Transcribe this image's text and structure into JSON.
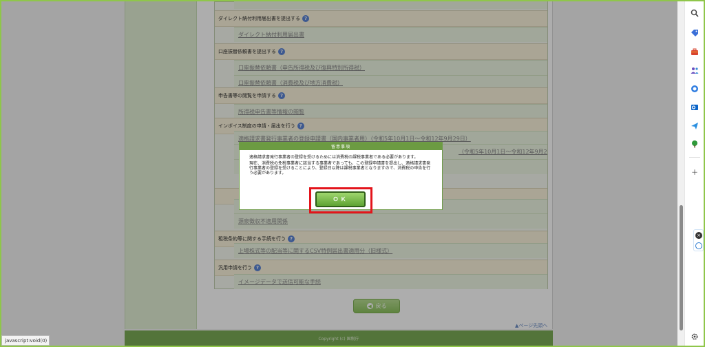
{
  "sections": [
    {
      "title": "ダイレクト納付利用届出書を提出する",
      "links": [
        "ダイレクト納付利用届出書"
      ]
    },
    {
      "title": "口座振替依頼書を提出する",
      "links": [
        "口座振替依頼書（申告所得税及び復興特別所得税）",
        "口座振替依頼書（消費税及び地方消費税）"
      ]
    },
    {
      "title": "申告書等の閲覧を申請する",
      "links": [
        "所得税申告書等情報の閲覧"
      ]
    },
    {
      "title": "インボイス制度の申請・届出を行う",
      "links": [
        "適格請求書発行事業者の登録申請書（国内事業者用）（令和5年10月1日～令和12年9月29日）",
        "（令和5年10月1日～令和12年9月29日）"
      ]
    },
    {
      "title": "",
      "links": [
        "源泉徴収不適用関係"
      ]
    },
    {
      "title": "租税条約等に関する手続を行う",
      "links": [
        "上場株式等の配当等に関するCSV特例届出書適用分（旧様式）"
      ]
    },
    {
      "title": "汎用申請を行う",
      "links": [
        "イメージデータで送信可能な手続"
      ]
    }
  ],
  "back_button": "戻る",
  "to_top": "ページ先頭へ",
  "footer": "Copyright (c) 国税庁",
  "modal": {
    "title": "留意事項",
    "paragraph1": "適格請求書発行事業者の登録を受けるためには消費税の課税事業者である必要があります。",
    "paragraph2": "現在、消費税の免税事業者に該当する事業者であっても、この登録申請書を提出し、適格請求書発行事業者の登録を受けることにより、登録日以降は課税事業者となりますので、消費税の申告を行う必要があります。",
    "ok_label": "ＯＫ"
  },
  "status_bar": "javascript:void(0)",
  "right_bar_icons": [
    "search-icon",
    "tag-icon",
    "toolbox-icon",
    "people-icon",
    "copilot-icon",
    "outlook-icon",
    "send-icon",
    "tree-icon",
    "plus-icon",
    "settings-icon"
  ],
  "colors": {
    "accent_green": "#6c9b42",
    "highlight_red": "#e3141b"
  }
}
